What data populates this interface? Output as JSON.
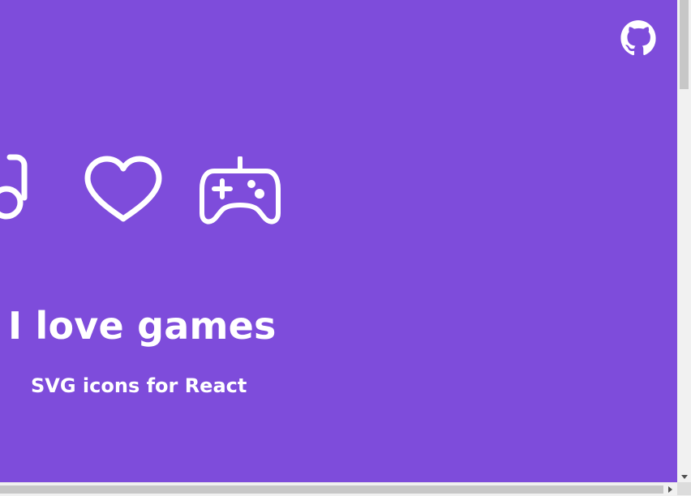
{
  "page": {
    "title": "I love games",
    "subtitle": "SVG icons for React"
  },
  "header": {
    "github_icon": "github-icon"
  },
  "icons": [
    {
      "name": "glasses-icon"
    },
    {
      "name": "heart-icon"
    },
    {
      "name": "gamepad-icon"
    }
  ],
  "colors": {
    "background": "#7e4cdb",
    "foreground": "#ffffff"
  }
}
